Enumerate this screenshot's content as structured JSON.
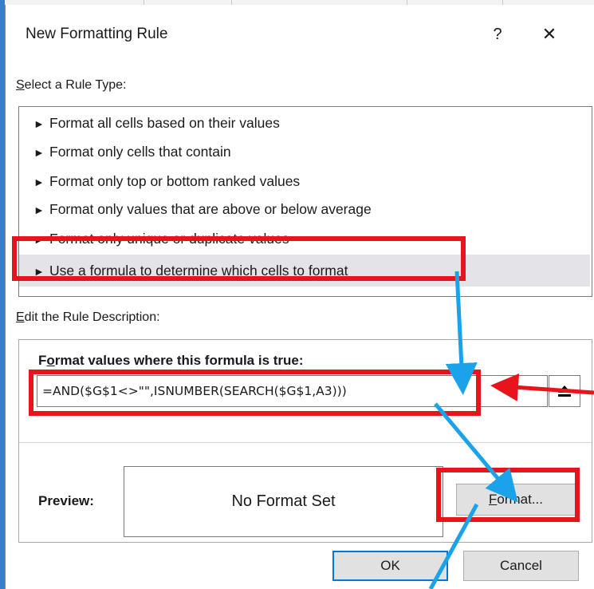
{
  "dialog": {
    "title": "New Formatting Rule",
    "help_label": "?",
    "close_label": "✕"
  },
  "rule_type": {
    "label_underlined": "S",
    "label_rest": "elect a Rule Type:",
    "items": [
      {
        "label": "Format all cells based on their values"
      },
      {
        "label": "Format only cells that contain"
      },
      {
        "label": "Format only top or bottom ranked values"
      },
      {
        "label": "Format only values that are above or below average"
      },
      {
        "label": "Format only unique or duplicate values"
      },
      {
        "label": "Use a formula to determine which cells to format",
        "selected": true
      }
    ]
  },
  "rule_description": {
    "label_underlined": "E",
    "label_rest": "dit the Rule Description:",
    "formula_label_pre": "F",
    "formula_label_underlined": "o",
    "formula_label_rest": "rmat values where this formula is true:",
    "formula_value": "=AND($G$1<>\"\",ISNUMBER(SEARCH($G$1,A3)))",
    "preview_label": "Preview:",
    "preview_text": "No Format Set",
    "format_button_underlined": "F",
    "format_button_rest": "ormat..."
  },
  "buttons": {
    "ok": "OK",
    "cancel": "Cancel"
  },
  "annotation_colors": {
    "highlight": "#e8141c",
    "arrow_blue": "#1aa3e8",
    "arrow_red": "#e8141c"
  },
  "icons": [
    "collapse-dialog-icon",
    "rule-arrow-icon",
    "close-icon",
    "help-icon"
  ]
}
